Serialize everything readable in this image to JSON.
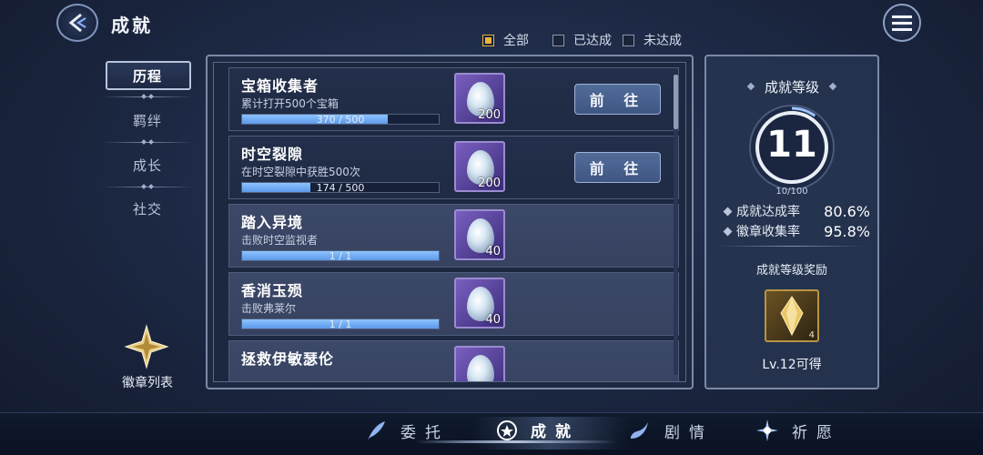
{
  "header": {
    "title": "成就"
  },
  "filters": [
    {
      "label": "全部",
      "checked": true
    },
    {
      "label": "已达成",
      "checked": false
    },
    {
      "label": "未达成",
      "checked": false
    }
  ],
  "nav": {
    "items": [
      "历程",
      "羁绊",
      "成长",
      "社交"
    ],
    "active": "历程",
    "badge_list_label": "徽章列表"
  },
  "achievements": [
    {
      "title": "宝箱收集者",
      "desc": "累计打开500个宝箱",
      "progress_text": "370 / 500",
      "progress": 0.74,
      "reward_count": "200",
      "action": "前 往",
      "highlight": false
    },
    {
      "title": "时空裂隙",
      "desc": "在时空裂隙中获胜500次",
      "progress_text": "174 / 500",
      "progress": 0.348,
      "reward_count": "200",
      "action": "前 往",
      "highlight": false
    },
    {
      "title": "踏入异境",
      "desc": "击败时空监视者",
      "progress_text": "1 / 1",
      "progress": 1.0,
      "reward_count": "40",
      "action": "",
      "highlight": true
    },
    {
      "title": "香消玉殒",
      "desc": "击败弗莱尔",
      "progress_text": "1 / 1",
      "progress": 1.0,
      "reward_count": "40",
      "action": "",
      "highlight": true
    },
    {
      "title": "拯救伊敏瑟伦",
      "desc": "",
      "progress_text": "",
      "progress": 0,
      "reward_count": "",
      "action": "",
      "highlight": true
    }
  ],
  "level": {
    "title": "成就等级",
    "value": "11",
    "progress_text": "10/100",
    "progress": 0.1,
    "completion_label": "成就达成率",
    "completion_value": "80.6%",
    "badge_label": "徽章收集率",
    "badge_value": "95.8%",
    "reward_title": "成就等级奖励",
    "reward_count": "4",
    "reward_note": "Lv.12可得"
  },
  "bottom_tabs": [
    "委托",
    "成就",
    "剧情",
    "祈愿"
  ],
  "colors": {
    "accent": "#f0b23b",
    "progress": "#7ab2f7",
    "panel": "#1c2740"
  }
}
